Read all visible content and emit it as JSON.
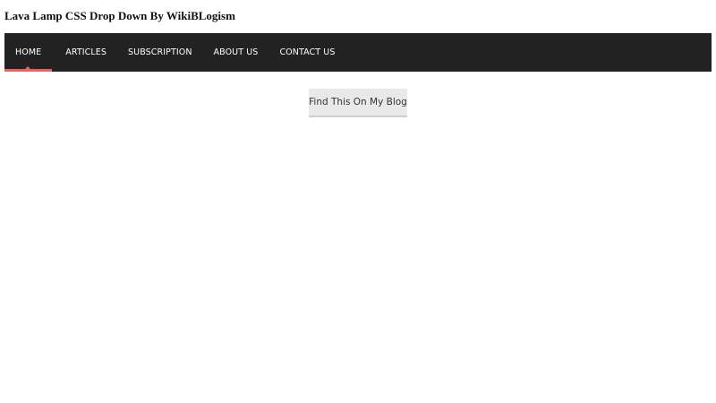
{
  "page": {
    "heading": "Lava Lamp CSS Drop Down By WikiBLogism"
  },
  "nav": {
    "items": [
      {
        "label": "HOME"
      },
      {
        "label": "ARTICLES"
      },
      {
        "label": "SUBSCRIPTION"
      },
      {
        "label": "ABOUT US"
      },
      {
        "label": "CONTACT US"
      }
    ],
    "active_item": "HOME",
    "colors": {
      "bar": "#222222",
      "text": "#ffffff",
      "indicator": "#e8635f"
    }
  },
  "button": {
    "label": "Find This On My Blog"
  }
}
